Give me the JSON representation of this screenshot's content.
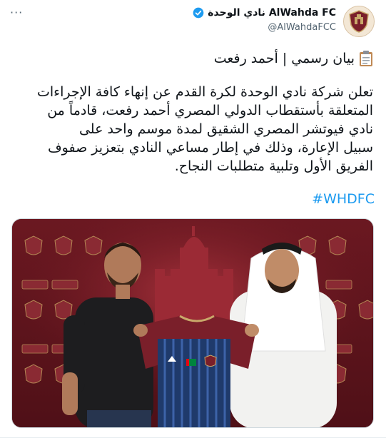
{
  "tweet": {
    "display_name": "AlWahda FC نادي الوحدة",
    "handle": "@AlWahdaFCC",
    "more_label": "···",
    "heading": "بيان رسمي | أحمد رفعت",
    "body_lines": [
      "تعلن شركة نادي الوحدة لكرة القدم عن إنهاء كافة الإجراءات",
      "المتعلقة بأستقطاب الدولي المصري أحمد رفعت، قادماً من",
      "نادي فيوتشر المصري الشقيق لمدة موسم واحد على",
      "سبيل الإعارة، وذلك في إطار مساعي النادي بتعزيز صفوف",
      "الفريق الأول وتلبية متطلبات النجاح."
    ],
    "hashtag": "#WHDFC"
  },
  "icons": {
    "verified": "verified-badge-icon",
    "heading": "clipboard-icon",
    "more": "more-options-icon"
  },
  "colors": {
    "accent": "#1d9bf0",
    "club_maroon": "#7a1f2a",
    "jersey_navy": "#1f3a6b"
  }
}
